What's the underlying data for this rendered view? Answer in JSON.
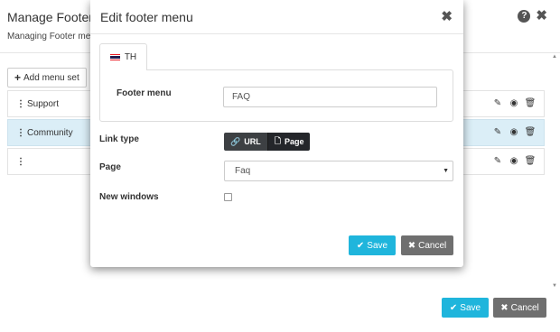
{
  "background": {
    "title": "Manage Footer m",
    "subtitle": "Managing Footer me",
    "help_icon": "?",
    "close_icon": "✖",
    "add_button": "Add menu set",
    "rows": [
      {
        "label": "Support",
        "active": false
      },
      {
        "label": "Community",
        "active": true
      },
      {
        "label": "",
        "active": false
      }
    ],
    "save_label": "Save",
    "cancel_label": "Cancel"
  },
  "modal": {
    "title": "Edit footer menu",
    "close_icon": "✖",
    "tab_label": "TH",
    "footer_menu_label": "Footer menu",
    "footer_menu_value": "FAQ",
    "link_type_label": "Link type",
    "link_type_options": [
      "URL",
      "Page"
    ],
    "link_type_selected": "Page",
    "page_label": "Page",
    "page_value": "Faq",
    "new_windows_label": "New windows",
    "new_windows_checked": false,
    "save_label": "Save",
    "cancel_label": "Cancel"
  },
  "colors": {
    "primary": "#1fb5dc",
    "secondary": "#6f6f6f",
    "active_row": "#dbeef7",
    "link_type_bg": "#3d4043"
  }
}
